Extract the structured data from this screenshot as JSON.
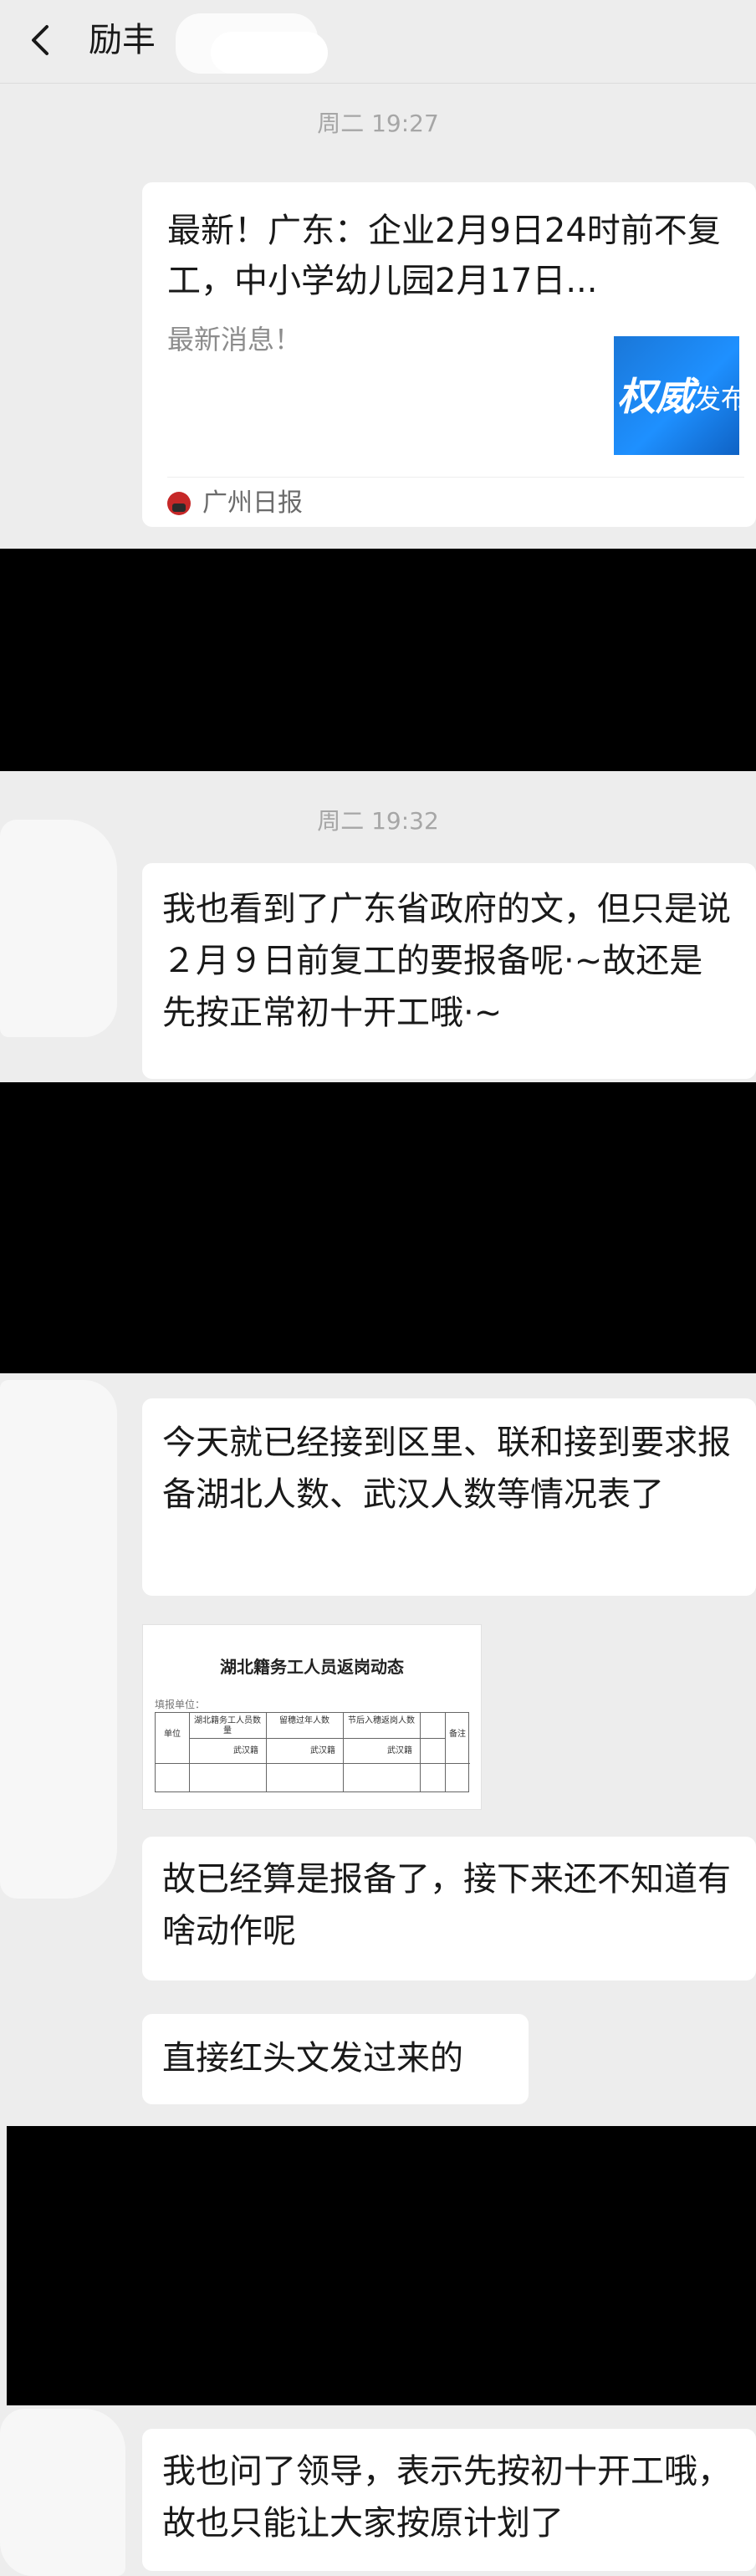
{
  "header": {
    "title": "励丰"
  },
  "messages": {
    "time1": "周二 19:27",
    "card": {
      "title": "最新！广东：企业2月9日24时前不复工，中小学幼儿园2月17日...",
      "description": "最新消息！",
      "thumb_text": "权威",
      "thumb_text2": "发布",
      "source": "广州日报"
    },
    "time2": "周二 19:32",
    "msg1": "我也看到了广东省政府的文，但只是说２月９日前复工的要报备呢·~故还是先按正常初十开工哦·~",
    "msg2": "今天就已经接到区里、联和接到要求报备湖北人数、武汉人数等情况表了",
    "doc": {
      "heading": "湖北籍务工人员返岗动态",
      "sub": "填报单位：",
      "col_unit": "单位",
      "col_a": "湖北籍务工人员数量",
      "col_b": "留穗过年人数",
      "col_c": "节后入穗返岗人数",
      "col_note": "备注",
      "col_wuhan": "武汉籍"
    },
    "msg3": "故已经算是报备了，接下来还不知道有啥动作呢",
    "msg4": "直接红头文发过来的",
    "msg5": "我也问了领导，表示先按初十开工哦，故也只能让大家按原计划了"
  }
}
